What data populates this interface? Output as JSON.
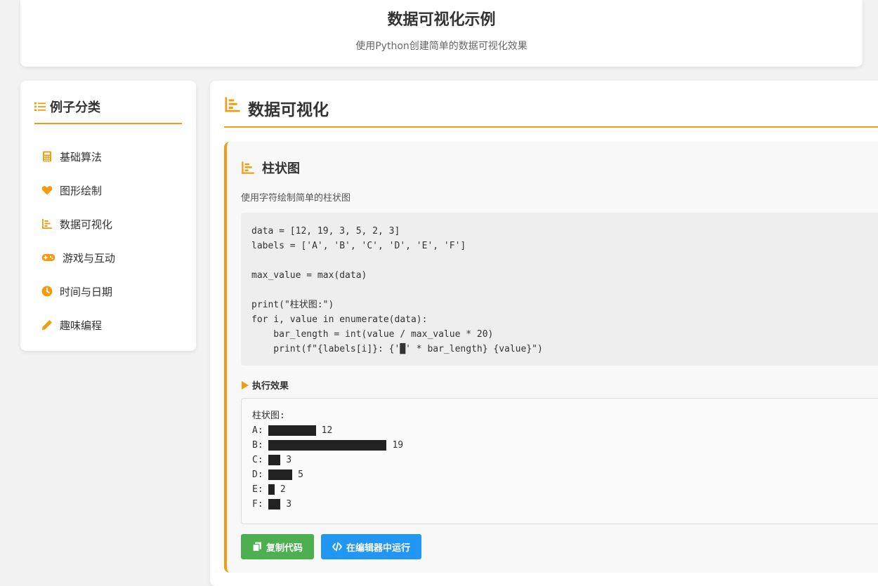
{
  "header": {
    "title": "数据可视化示例",
    "subtitle": "使用Python创建简单的数据可视化效果"
  },
  "sidebar": {
    "title": "例子分类",
    "items": [
      {
        "label": "基础算法",
        "icon": "calculator-icon"
      },
      {
        "label": "图形绘制",
        "icon": "heart-icon"
      },
      {
        "label": "数据可视化",
        "icon": "chart-bar-icon"
      },
      {
        "label": "游戏与互动",
        "icon": "gamepad-icon"
      },
      {
        "label": "时间与日期",
        "icon": "clock-icon"
      },
      {
        "label": "趣味编程",
        "icon": "pencil-icon"
      }
    ]
  },
  "main": {
    "title": "数据可视化",
    "card": {
      "title": "柱状图",
      "description": "使用字符绘制简单的柱状图",
      "code": "data = [12, 19, 3, 5, 2, 3]\nlabels = ['A', 'B', 'C', 'D', 'E', 'F']\n\nmax_value = max(data)\n\nprint(\"柱状图:\")\nfor i, value in enumerate(data):\n    bar_length = int(value / max_value * 20)\n    print(f\"{labels[i]}: {'█' * bar_length} {value}\")",
      "output_label": "执行效果",
      "output": {
        "heading": "柱状图:",
        "rows": [
          {
            "label": "A",
            "value": 12,
            "bar_length": 8
          },
          {
            "label": "B",
            "value": 19,
            "bar_length": 20
          },
          {
            "label": "C",
            "value": 3,
            "bar_length": 2
          },
          {
            "label": "D",
            "value": 5,
            "bar_length": 4
          },
          {
            "label": "E",
            "value": 2,
            "bar_length": 1
          },
          {
            "label": "F",
            "value": 3,
            "bar_length": 2
          }
        ]
      },
      "buttons": {
        "copy_label": "复制代码",
        "run_label": "在编辑器中运行"
      }
    }
  },
  "colors": {
    "accent": "#f39c12",
    "copy_button": "#4caf50",
    "run_button": "#2196f3"
  }
}
